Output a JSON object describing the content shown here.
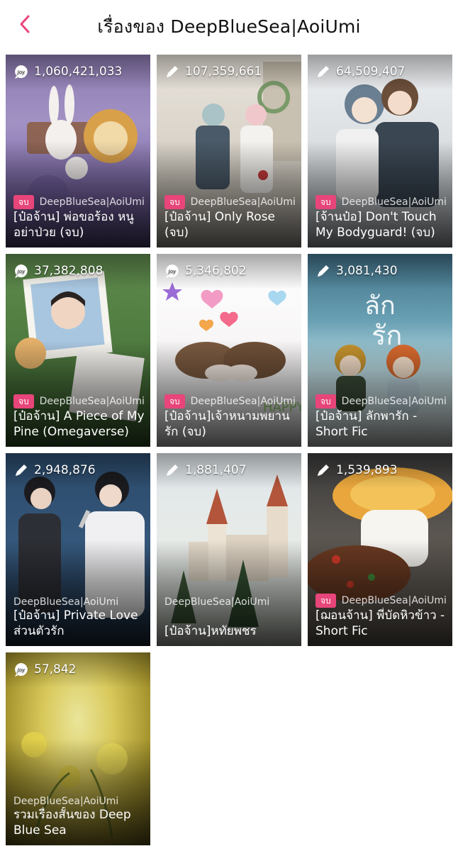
{
  "header": {
    "title": "เรื่องของ DeepBlueSea|AoiUmi"
  },
  "colors": {
    "accent": "#e8457a"
  },
  "stories": [
    {
      "views": "1,060,421,033",
      "icon": "joy-chat-icon",
      "status": "จบ",
      "author": "DeepBlueSea|AoiUmi",
      "title": "[ป๋อจ้าน] พ่อขอร้อง หนูอย่าป่วย (จบ)"
    },
    {
      "views": "107,359,661",
      "icon": "pen-icon",
      "status": "จบ",
      "author": "DeepBlueSea|AoiUmi",
      "title": "[ป๋อจ้าน] Only Rose (จบ)"
    },
    {
      "views": "64,509,407",
      "icon": "pen-icon",
      "status": "จบ",
      "author": "DeepBlueSea|AoiUmi",
      "title": "[จ้านป๋อ] Don't Touch My Bodyguard! (จบ)"
    },
    {
      "views": "37,382,808",
      "icon": "joy-chat-icon",
      "status": "จบ",
      "author": "DeepBlueSea|AoiUmi",
      "title": "[ป๋อจ้าน] A Piece of My Pine (Omegaverse)"
    },
    {
      "views": "5,346,802",
      "icon": "joy-chat-icon",
      "status": "จบ",
      "author": "DeepBlueSea|AoiUmi",
      "title": "[ป๋อจ้าน]เจ้าหนามพยานรัก (จบ)"
    },
    {
      "views": "3,081,430",
      "icon": "pen-icon",
      "status": "จบ",
      "author": "DeepBlueSea|AoiUmi",
      "title": "[ป๋อจ้าน] ลักพารัก - Short Fic"
    },
    {
      "views": "2,948,876",
      "icon": "pen-icon",
      "status": "",
      "author": "DeepBlueSea|AoiUmi",
      "title": "[ป๋อจ้าน] Private Love ส่วนตัวรัก"
    },
    {
      "views": "1,881,407",
      "icon": "pen-icon",
      "status": "",
      "author": "DeepBlueSea|AoiUmi",
      "title": "[ป๋อจ้าน]หทัยพชร"
    },
    {
      "views": "1,539,893",
      "icon": "pen-icon",
      "status": "จบ",
      "author": "DeepBlueSea|AoiUmi",
      "title": "[ฌอนจ้าน] พี่บัดหิวข้าว - Short Fic"
    },
    {
      "views": "57,842",
      "icon": "joy-chat-icon",
      "status": "",
      "author": "DeepBlueSea|AoiUmi",
      "title": "รวมเรื่องสั้นของ Deep Blue Sea"
    }
  ]
}
